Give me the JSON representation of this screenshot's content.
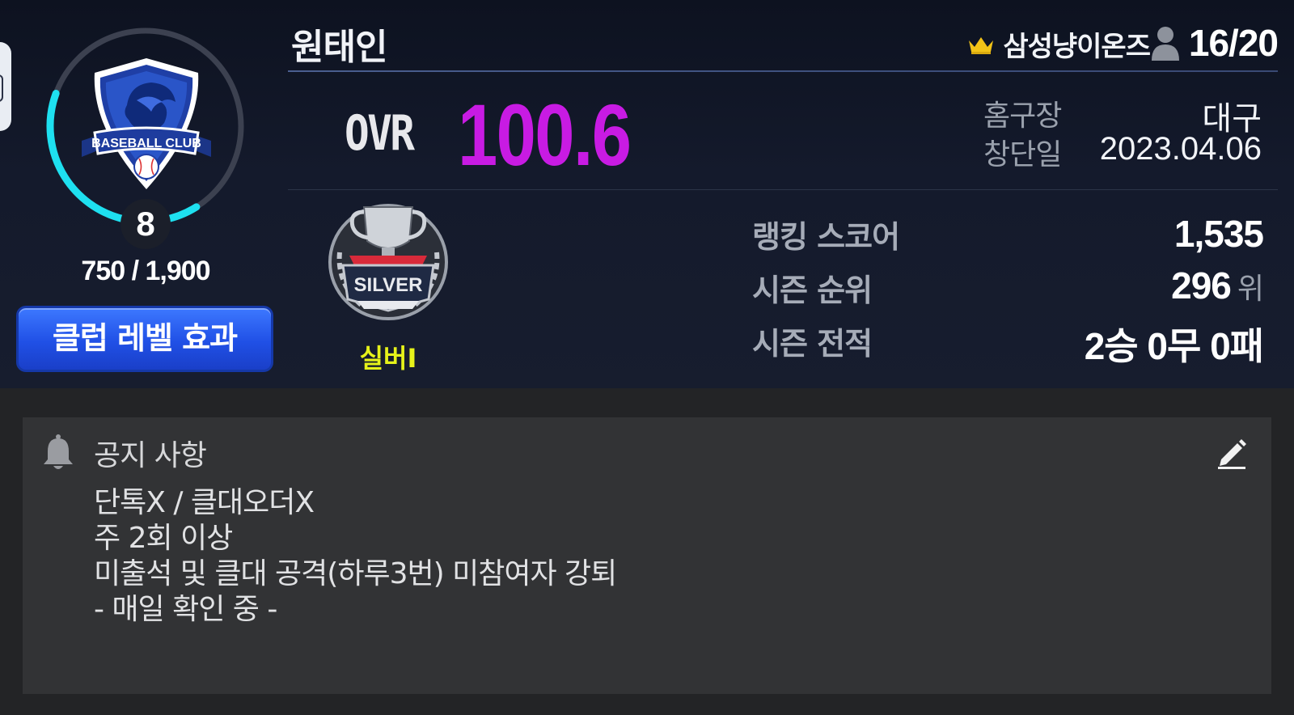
{
  "club": {
    "name": "원태인",
    "level": "8",
    "exp_text": "750 / 1,900",
    "exp_progress": 0.395,
    "emblem_text": "BASEBALL CLUB",
    "level_effect_button": "클럽 레벨 효과"
  },
  "owner": {
    "name": "삼성냥이온즈",
    "members": "16/20"
  },
  "ovr": {
    "label": "OVR",
    "value": "100.6"
  },
  "info": {
    "home_label": "홈구장",
    "home_value": "대구",
    "founded_label": "창단일",
    "founded_value": "2023.04.06"
  },
  "tier": {
    "name": "실버I",
    "emblem_text": "SILVER"
  },
  "stats": {
    "ranking_score_label": "랭킹 스코어",
    "ranking_score_value": "1,535",
    "season_rank_label": "시즌 순위",
    "season_rank_value": "296",
    "season_rank_unit": "위",
    "season_record_label": "시즌 전적",
    "season_record_value": "2승 0무 0패"
  },
  "notice": {
    "title": "공지 사항",
    "lines": [
      "단톡X / 클대오더X",
      "주 2회 이상",
      "미출석 및 클대 공격(하루3번) 미참여자 강퇴",
      "- 매일 확인 중 -"
    ]
  },
  "icons": {
    "crown": "crown-icon",
    "person": "person-icon",
    "bell": "bell-icon",
    "edit": "edit-icon"
  },
  "colors": {
    "ovr_value": "#c81be3",
    "tier_name": "#e6f21a",
    "exp_ring": "#1ee0f0",
    "button_blue": "#2556f0"
  }
}
